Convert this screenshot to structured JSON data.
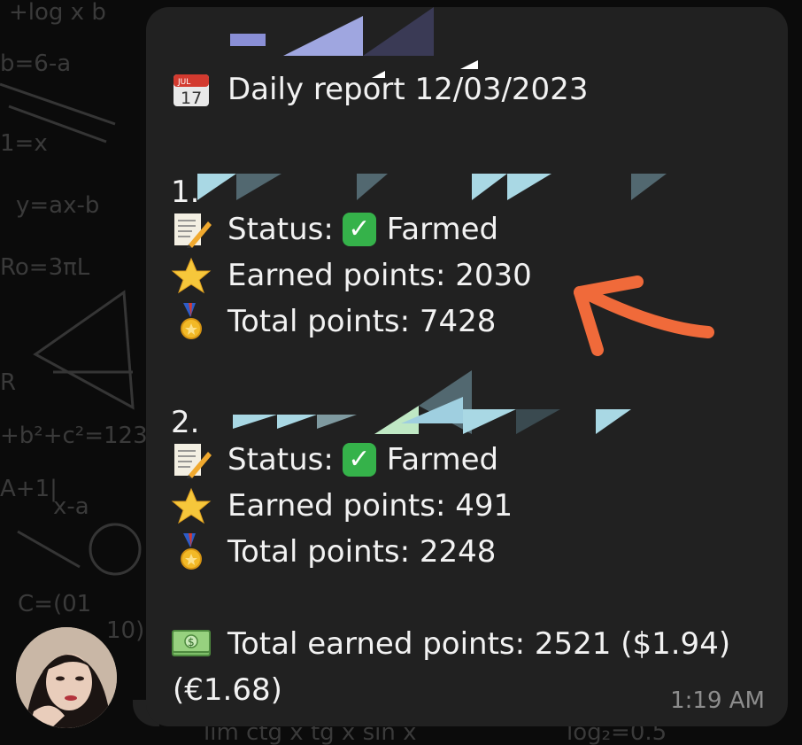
{
  "report": {
    "title": "Daily report 12/03/2023",
    "account1": {
      "index": "1.",
      "status_label": "Status:",
      "status_value": "Farmed",
      "earned_label": "Earned points: 2030",
      "total_label": "Total points: 7428"
    },
    "account2": {
      "index": "2.",
      "status_label": "Status:",
      "status_value": "Farmed",
      "earned_label": "Earned points: 491",
      "total_label": "Total points: 2248"
    },
    "summary_line1": "Total earned points: 2521 ($1.94)",
    "summary_line2": "(€1.68)",
    "time": "1:19 AM"
  },
  "colors": {
    "bubble": "#212121",
    "text": "#f2f2f2",
    "check": "#35b24a",
    "arrow": "#f06a3a",
    "timestamp": "#8d8d8d"
  },
  "icons": {
    "calendar": "calendar-icon",
    "memo": "memo-icon",
    "star": "star-icon",
    "medal": "medal-icon",
    "money": "money-icon",
    "check": "check-mark-icon"
  }
}
